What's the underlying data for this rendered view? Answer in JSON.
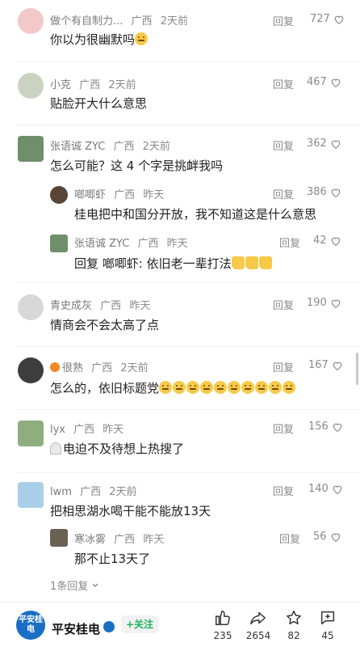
{
  "reply_label": "回复",
  "comments": [
    {
      "name": "做个有自制力...",
      "region": "广西",
      "time": "2天前",
      "text": "你以为很幽默吗",
      "likes": "727"
    },
    {
      "name": "小克",
      "region": "广西",
      "time": "2天前",
      "text": "贴脸开大什么意思",
      "likes": "467"
    },
    {
      "name": "张语诚 ZYC",
      "region": "广西",
      "time": "2天前",
      "text": "怎么可能？这 4 个字是挑衅我吗",
      "likes": "362"
    },
    {
      "name": "啷唧虾",
      "region": "广西",
      "time": "昨天",
      "text": "桂电把中和国分开放，我不知道这是什么意思",
      "likes": "386"
    },
    {
      "name": "张语诚 ZYC",
      "region": "广西",
      "time": "昨天",
      "text": "回复 啷唧虾: 依旧老一辈打法",
      "likes": "42"
    },
    {
      "name": "青史成灰",
      "region": "广西",
      "time": "昨天",
      "text": "情商会不会太高了点",
      "likes": "190"
    },
    {
      "name": "很熟",
      "region": "广西",
      "time": "2天前",
      "text": "怎么的，依旧标题党",
      "likes": "167"
    },
    {
      "name": "lyx",
      "region": "广西",
      "time": "昨天",
      "text": "电迫不及待想上热搜了",
      "likes": "156"
    },
    {
      "name": "lwm",
      "region": "广西",
      "time": "2天前",
      "text": "把相思湖水喝干能不能放13天",
      "likes": "140"
    },
    {
      "name": "寒冰雾",
      "region": "广西",
      "time": "昨天",
      "text": "那不止13天了",
      "likes": "56"
    }
  ],
  "more_replies": "1条回复",
  "footer": {
    "logo_text": "平安桂电",
    "account": "平安桂电",
    "follow": "+关注",
    "likes": "235",
    "shares": "2654",
    "favorites": "82",
    "comments": "45"
  },
  "colors": {
    "accent": "#1a6fc4",
    "follow_green": "#1bb359",
    "muted": "#8a8a8a"
  }
}
